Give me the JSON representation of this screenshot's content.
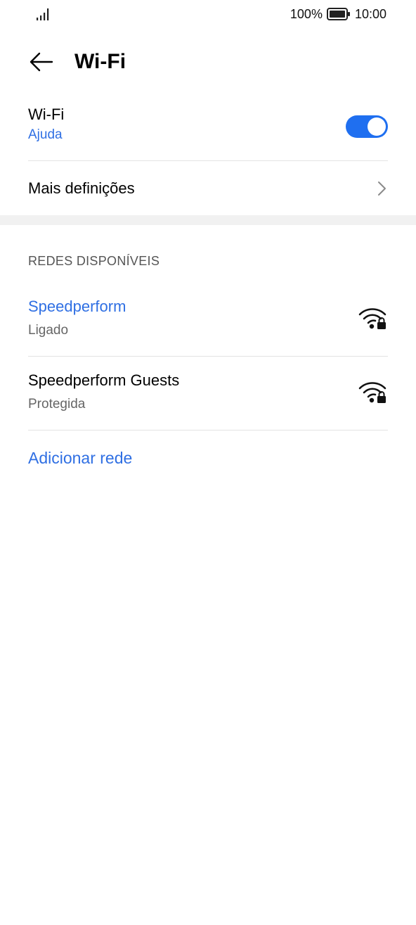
{
  "status_bar": {
    "battery_percent": "100%",
    "time": "10:00",
    "signal_icon": "signal-icon",
    "battery_icon": "battery-icon"
  },
  "header": {
    "title": "Wi-Fi",
    "back_icon": "arrow-left-icon"
  },
  "wifi_toggle": {
    "label": "Wi-Fi",
    "help_link": "Ajuda",
    "enabled": true,
    "accent_color": "#1f6ff0"
  },
  "more_settings": {
    "label": "Mais definições",
    "icon": "chevron-right-icon"
  },
  "networks": {
    "section_title": "REDES DISPONÍVEIS",
    "items": [
      {
        "name": "Speedperform",
        "status": "Ligado",
        "connected": true,
        "icon": "wifi-lock-icon"
      },
      {
        "name": "Speedperform Guests",
        "status": "Protegida",
        "connected": false,
        "icon": "wifi-lock-icon"
      }
    ],
    "add_label": "Adicionar rede",
    "link_color": "#2f6fe3"
  }
}
